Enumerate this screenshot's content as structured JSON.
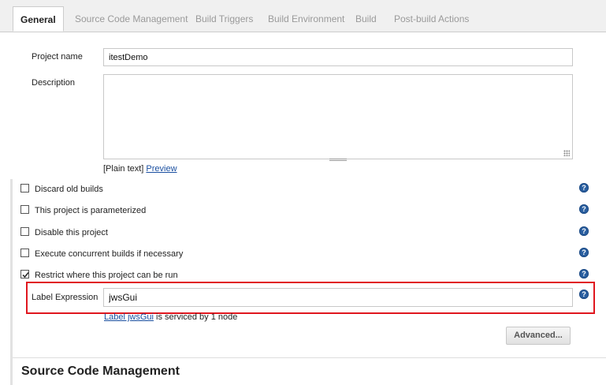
{
  "tabs": [
    {
      "label": "General",
      "active": true
    },
    {
      "label": "Source Code Management"
    },
    {
      "label": "Build Triggers"
    },
    {
      "label": "Build Environment"
    },
    {
      "label": "Build"
    },
    {
      "label": "Post-build Actions"
    }
  ],
  "project": {
    "name_label": "Project name",
    "name_value": "itestDemo",
    "description_label": "Description",
    "plain_text": "[Plain text]",
    "preview_link": "Preview"
  },
  "options": [
    {
      "label": "Discard old builds",
      "checked": false
    },
    {
      "label": "This project is parameterized",
      "checked": false
    },
    {
      "label": "Disable this project",
      "checked": false
    },
    {
      "label": "Execute concurrent builds if necessary",
      "checked": false
    },
    {
      "label": "Restrict where this project can be run",
      "checked": true
    }
  ],
  "label_expression": {
    "label": "Label Expression",
    "value": "jwsGui",
    "info_link": "Label jwsGui",
    "info_text": " is serviced by 1 node"
  },
  "advanced_button": "Advanced...",
  "section_title": "Source Code Management",
  "help_glyph": "?",
  "colors": {
    "highlight": "#e0161e",
    "help": "#2a5fa0",
    "link": "#1a4fa0"
  },
  "icons": [
    "help-icon",
    "checkmark-icon",
    "resize-grip-icon"
  ]
}
